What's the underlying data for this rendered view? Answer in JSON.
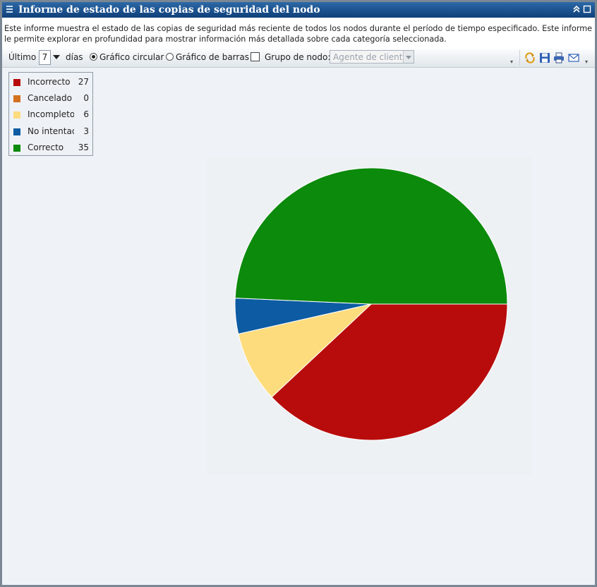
{
  "window": {
    "title": "Informe de estado de las copias de seguridad del nodo",
    "title_color": "#1a4f8a"
  },
  "description": {
    "line1": "Este informe muestra el estado de las copias de seguridad más reciente de todos los nodos durante el período de tiempo especificado. Este informe",
    "line2": "le permite explorar en profundidad para mostrar información más detallada sobre cada categoría seleccionada."
  },
  "toolbar": {
    "last_label": "Último",
    "days_value": "7",
    "days_label": "días",
    "pie_option": "Gráfico circular",
    "bar_option": "Gráfico de barras",
    "selected_option": "Gráfico circular",
    "group_label": "Grupo de nodo:",
    "group_checked": false,
    "group_select_value": "Agente de cliente",
    "icons": [
      "refresh-icon",
      "save-icon",
      "print-icon",
      "email-icon"
    ]
  },
  "chart_data": {
    "type": "pie",
    "start_angle_deg": 0,
    "direction": "clockwise",
    "legend_position": "top-left",
    "categories": [
      "Incorrecto",
      "Cancelado",
      "Incompleto",
      "No intentado",
      "Correcto"
    ],
    "values": [
      27,
      0,
      6,
      3,
      35
    ],
    "colors": [
      "#b80c0c",
      "#d4711e",
      "#fddc7e",
      "#0d5ba3",
      "#0b8a0b"
    ]
  }
}
